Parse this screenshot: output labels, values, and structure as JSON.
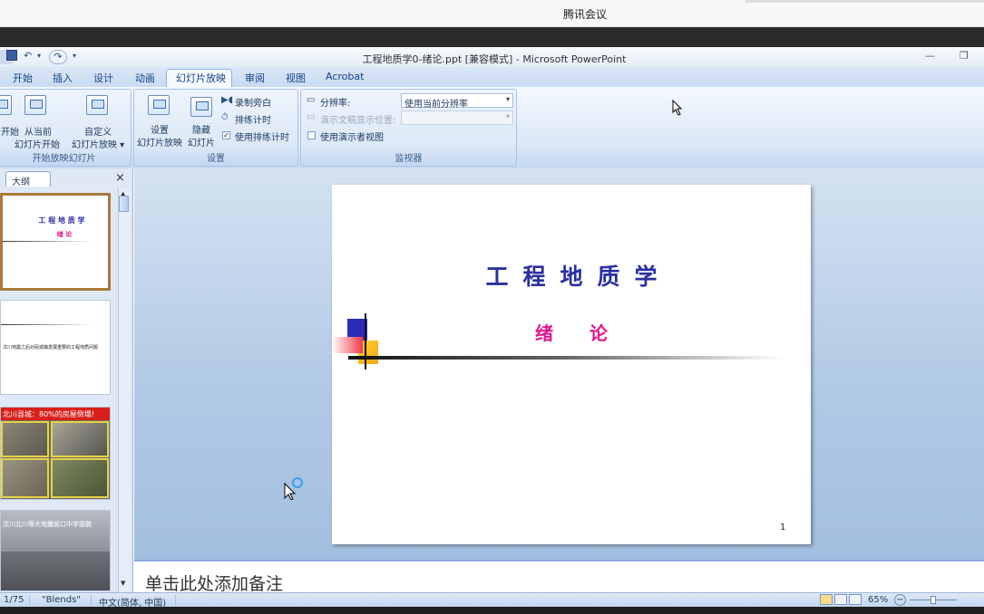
{
  "meeting": {
    "app_title": "腾讯会议"
  },
  "window": {
    "doc_title": "工程地质学0-绪论.ppt [兼容模式] - Microsoft PowerPoint",
    "min": "—",
    "restore": "❐"
  },
  "qat": {
    "undo": "↶",
    "redo": "↷"
  },
  "tabs": [
    "开始",
    "插入",
    "设计",
    "动画",
    "幻灯片放映",
    "审阅",
    "视图",
    "Acrobat"
  ],
  "ribbon": {
    "group1": {
      "label": "开始放映幻灯片",
      "from_begin": "开始",
      "from_current_1": "从当前",
      "from_current_2": "幻灯片开始",
      "custom_1": "自定义",
      "custom_2": "幻灯片放映 ▾"
    },
    "group2": {
      "label": "设置",
      "setup_1": "设置",
      "setup_2": "幻灯片放映",
      "hide_1": "隐藏",
      "hide_2": "幻灯片",
      "record": "录制旁白",
      "rehearse": "排练计时",
      "use_timings": "使用排练计时",
      "use_timings_checked": "✓"
    },
    "group3": {
      "label": "监视器",
      "resolution_label": "分辨率:",
      "resolution_value": "使用当前分辨率",
      "show_on_label": "演示文稿显示位置:",
      "show_on_value": "",
      "presenter_view": "使用演示者视图"
    }
  },
  "left_pane": {
    "tab_outline": "大纲",
    "close": "×",
    "thumbs": [
      {
        "title": "工 程 地 质 学",
        "sub": "绪   论"
      },
      {
        "text": "汶川地震之后对民城镇发展重要的工程地质问题"
      },
      {
        "caption": "北川县城：80%的房屋倒塌!"
      },
      {
        "caption": "汶川北川等大地震面口中学面貌"
      }
    ]
  },
  "slide": {
    "title": "工程地质学",
    "subtitle": "绪论",
    "number": "1"
  },
  "notes": {
    "placeholder": "单击此处添加备注"
  },
  "status": {
    "slide_pos": "1/75",
    "theme": "\"Blends\"",
    "language": "中文(简体, 中国)",
    "zoom": "65%",
    "zoom_minus": "−"
  },
  "colors": {
    "title": "#2a2fa0",
    "subtitle": "#e4148a",
    "ribbon_bg": "#dbe8f7",
    "canvas_bg": "#b0c8e4"
  }
}
